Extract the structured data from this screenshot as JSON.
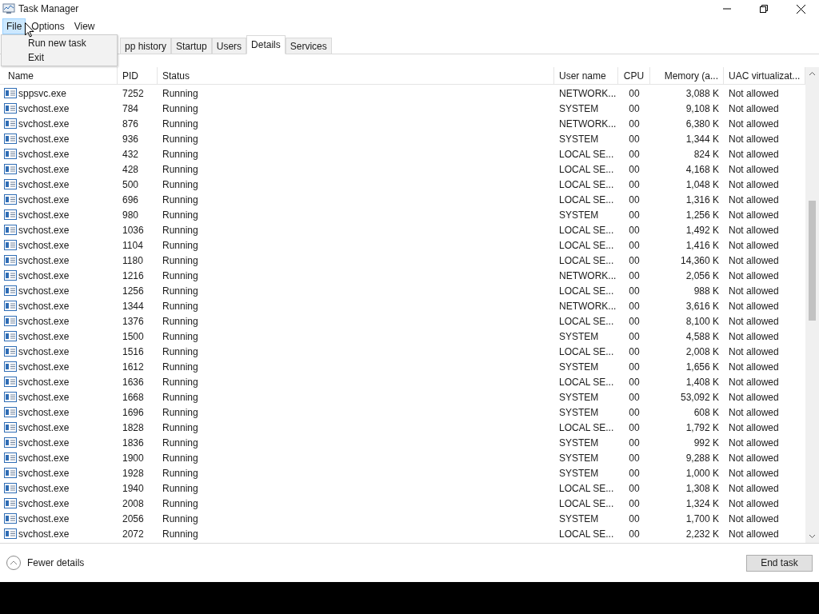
{
  "window": {
    "title": "Task Manager"
  },
  "menu": [
    {
      "label": "File",
      "selected": true
    },
    {
      "label": "Options",
      "selected": false
    },
    {
      "label": "View",
      "selected": false
    }
  ],
  "dropdown": [
    "Run new task",
    "Exit"
  ],
  "tabs": [
    {
      "label": "pp history",
      "selected": false
    },
    {
      "label": "Startup",
      "selected": false
    },
    {
      "label": "Users",
      "selected": false
    },
    {
      "label": "Details",
      "selected": true
    },
    {
      "label": "Services",
      "selected": false
    }
  ],
  "table": {
    "columns": [
      "Name",
      "PID",
      "Status",
      "User name",
      "CPU",
      "Memory (a...",
      "UAC virtualizat..."
    ],
    "rows": [
      [
        "sppsvc.exe",
        "7252",
        "Running",
        "NETWORK...",
        "00",
        "3,088 K",
        "Not allowed"
      ],
      [
        "svchost.exe",
        "784",
        "Running",
        "SYSTEM",
        "00",
        "9,108 K",
        "Not allowed"
      ],
      [
        "svchost.exe",
        "876",
        "Running",
        "NETWORK...",
        "00",
        "6,380 K",
        "Not allowed"
      ],
      [
        "svchost.exe",
        "936",
        "Running",
        "SYSTEM",
        "00",
        "1,344 K",
        "Not allowed"
      ],
      [
        "svchost.exe",
        "432",
        "Running",
        "LOCAL SE...",
        "00",
        "824 K",
        "Not allowed"
      ],
      [
        "svchost.exe",
        "428",
        "Running",
        "LOCAL SE...",
        "00",
        "4,168 K",
        "Not allowed"
      ],
      [
        "svchost.exe",
        "500",
        "Running",
        "LOCAL SE...",
        "00",
        "1,048 K",
        "Not allowed"
      ],
      [
        "svchost.exe",
        "696",
        "Running",
        "LOCAL SE...",
        "00",
        "1,316 K",
        "Not allowed"
      ],
      [
        "svchost.exe",
        "980",
        "Running",
        "SYSTEM",
        "00",
        "1,256 K",
        "Not allowed"
      ],
      [
        "svchost.exe",
        "1036",
        "Running",
        "LOCAL SE...",
        "00",
        "1,492 K",
        "Not allowed"
      ],
      [
        "svchost.exe",
        "1104",
        "Running",
        "LOCAL SE...",
        "00",
        "1,416 K",
        "Not allowed"
      ],
      [
        "svchost.exe",
        "1180",
        "Running",
        "LOCAL SE...",
        "00",
        "14,360 K",
        "Not allowed"
      ],
      [
        "svchost.exe",
        "1216",
        "Running",
        "NETWORK...",
        "00",
        "2,056 K",
        "Not allowed"
      ],
      [
        "svchost.exe",
        "1256",
        "Running",
        "LOCAL SE...",
        "00",
        "988 K",
        "Not allowed"
      ],
      [
        "svchost.exe",
        "1344",
        "Running",
        "NETWORK...",
        "00",
        "3,616 K",
        "Not allowed"
      ],
      [
        "svchost.exe",
        "1376",
        "Running",
        "LOCAL SE...",
        "00",
        "8,100 K",
        "Not allowed"
      ],
      [
        "svchost.exe",
        "1500",
        "Running",
        "SYSTEM",
        "00",
        "4,588 K",
        "Not allowed"
      ],
      [
        "svchost.exe",
        "1516",
        "Running",
        "LOCAL SE...",
        "00",
        "2,008 K",
        "Not allowed"
      ],
      [
        "svchost.exe",
        "1612",
        "Running",
        "SYSTEM",
        "00",
        "1,656 K",
        "Not allowed"
      ],
      [
        "svchost.exe",
        "1636",
        "Running",
        "LOCAL SE...",
        "00",
        "1,408 K",
        "Not allowed"
      ],
      [
        "svchost.exe",
        "1668",
        "Running",
        "SYSTEM",
        "00",
        "53,092 K",
        "Not allowed"
      ],
      [
        "svchost.exe",
        "1696",
        "Running",
        "SYSTEM",
        "00",
        "608 K",
        "Not allowed"
      ],
      [
        "svchost.exe",
        "1828",
        "Running",
        "LOCAL SE...",
        "00",
        "1,792 K",
        "Not allowed"
      ],
      [
        "svchost.exe",
        "1836",
        "Running",
        "SYSTEM",
        "00",
        "992 K",
        "Not allowed"
      ],
      [
        "svchost.exe",
        "1900",
        "Running",
        "SYSTEM",
        "00",
        "9,288 K",
        "Not allowed"
      ],
      [
        "svchost.exe",
        "1928",
        "Running",
        "SYSTEM",
        "00",
        "1,000 K",
        "Not allowed"
      ],
      [
        "svchost.exe",
        "1940",
        "Running",
        "LOCAL SE...",
        "00",
        "1,308 K",
        "Not allowed"
      ],
      [
        "svchost.exe",
        "2008",
        "Running",
        "LOCAL SE...",
        "00",
        "1,324 K",
        "Not allowed"
      ],
      [
        "svchost.exe",
        "2056",
        "Running",
        "SYSTEM",
        "00",
        "1,700 K",
        "Not allowed"
      ],
      [
        "svchost.exe",
        "2072",
        "Running",
        "LOCAL SE...",
        "00",
        "2,232 K",
        "Not allowed"
      ]
    ]
  },
  "footer": {
    "toggle": "Fewer details",
    "button": "End task"
  }
}
